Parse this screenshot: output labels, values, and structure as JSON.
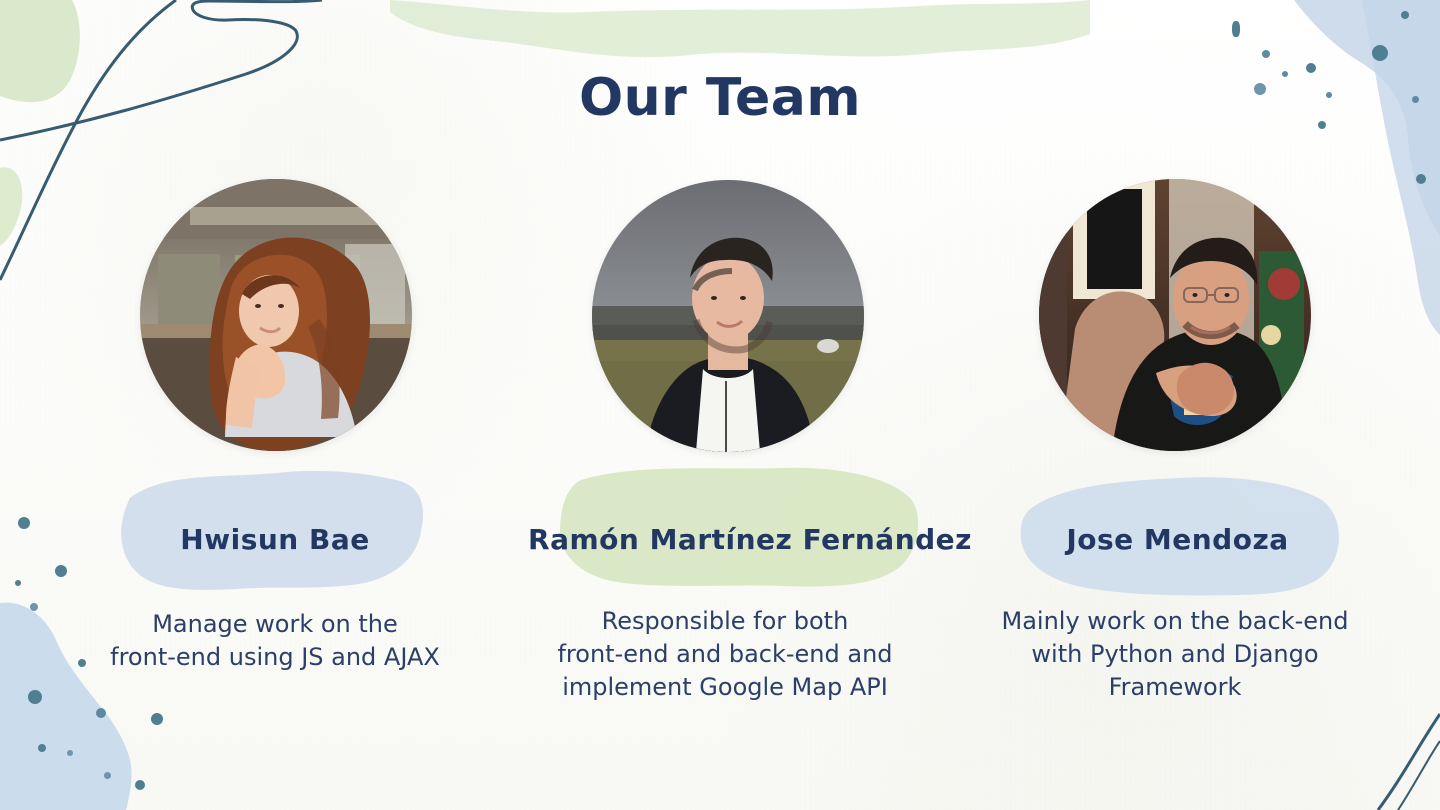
{
  "title": "Our Team",
  "team": [
    {
      "name": "Hwisun Bae",
      "role_lines": [
        "Manage work on the",
        "front-end using JS and AJAX"
      ]
    },
    {
      "name": "Ramón Martínez Fernández",
      "role_lines": [
        "Responsible for both",
        "front-end and back-end and",
        "implement Google Map API"
      ]
    },
    {
      "name": "Jose Mendoza",
      "role_lines": [
        "Mainly work on the back-end",
        "with Python and Django",
        "Framework"
      ]
    }
  ],
  "colors": {
    "title": "#233763",
    "text": "#2b3f68",
    "accent_blue": "#bfd0e8",
    "accent_green": "#d5e5bf",
    "line": "#365c71"
  },
  "icons": {
    "decor_stroke": "abstract-line-icon",
    "decor_dots": "splatter-dots-icon"
  }
}
